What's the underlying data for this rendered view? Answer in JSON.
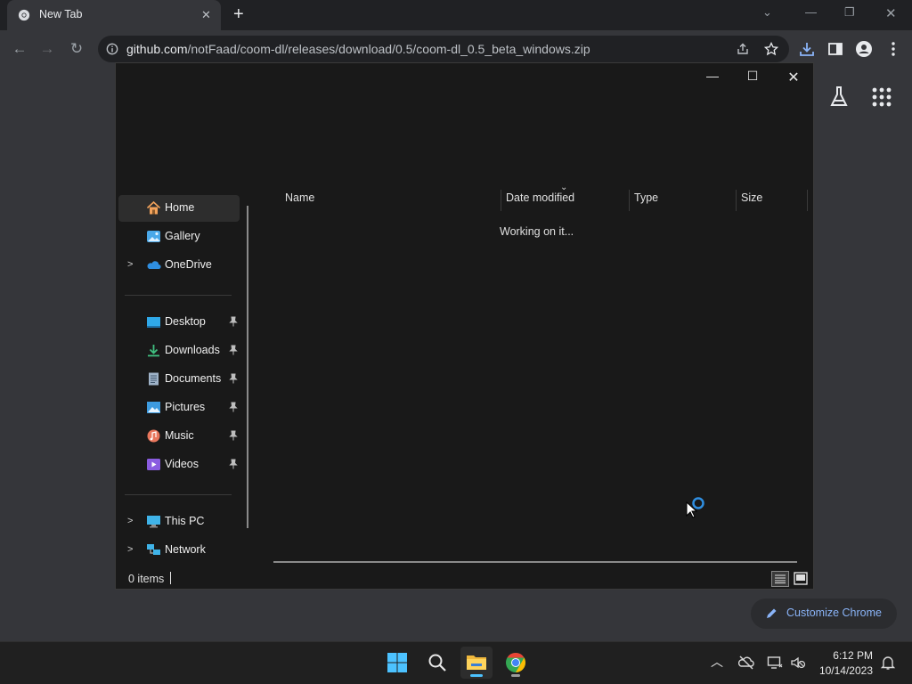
{
  "browser": {
    "tab": {
      "title": "New Tab"
    },
    "url": {
      "host": "github.com",
      "path": "/notFaad/coom-dl/releases/download/0.5/coom-dl_0.5_beta_windows.zip"
    },
    "customize_label": "Customize Chrome"
  },
  "dialog": {
    "nav": {
      "items": [
        {
          "label": "Home",
          "icon": "home-icon"
        },
        {
          "label": "Gallery",
          "icon": "gallery-icon"
        },
        {
          "label": "OneDrive",
          "icon": "cloud-icon"
        },
        {
          "label": "Desktop",
          "icon": "desktop-icon"
        },
        {
          "label": "Downloads",
          "icon": "download-icon"
        },
        {
          "label": "Documents",
          "icon": "documents-icon"
        },
        {
          "label": "Pictures",
          "icon": "pictures-icon"
        },
        {
          "label": "Music",
          "icon": "music-icon"
        },
        {
          "label": "Videos",
          "icon": "videos-icon"
        },
        {
          "label": "This PC",
          "icon": "pc-icon"
        },
        {
          "label": "Network",
          "icon": "network-icon"
        }
      ],
      "selected": "Home"
    },
    "columns": [
      "Name",
      "Date modified",
      "Type",
      "Size"
    ],
    "status_message": "Working on it...",
    "items_count": "0 items"
  },
  "taskbar": {
    "time": "6:12 PM",
    "date": "10/14/2023",
    "apps": [
      "start",
      "search",
      "file-explorer",
      "chrome"
    ]
  },
  "colors": {
    "accent": "#4cc2ff",
    "link": "#8ab4f8",
    "chrome_dark": "#35363a",
    "dialog_bg": "#191919"
  }
}
